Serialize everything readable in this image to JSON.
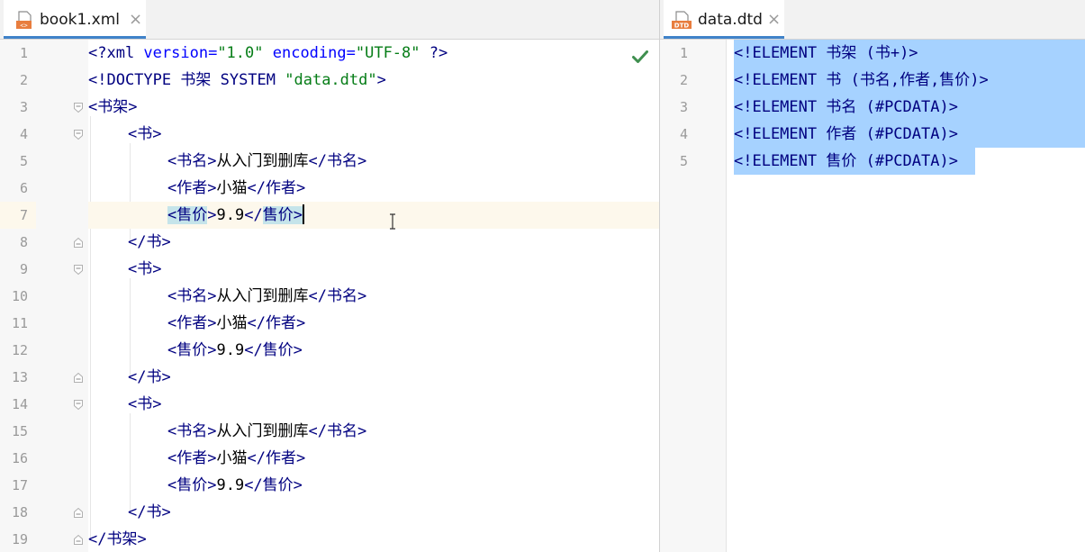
{
  "left": {
    "tab": {
      "icon": "xml-file-icon",
      "label": "book1.xml",
      "close": "×"
    },
    "status_icon": "checkmark-icon",
    "line_numbers": [
      "1",
      "2",
      "3",
      "4",
      "5",
      "6",
      "7",
      "8",
      "9",
      "10",
      "11",
      "12",
      "13",
      "14",
      "15",
      "16",
      "17",
      "18",
      "19"
    ],
    "lines": {
      "l1": {
        "pi_open": "<?xml ",
        "a1": "version=",
        "v1": "\"1.0\"",
        "a2": " encoding=",
        "v2": "\"UTF-8\"",
        "pi_close": " ?>"
      },
      "l2": {
        "kw": "<!DOCTYPE ",
        "name": "书架",
        "sys": " SYSTEM ",
        "str": "\"data.dtd\"",
        "close": ">"
      },
      "l3": {
        "tag": "<书架>"
      },
      "l4": {
        "tag": "<书>"
      },
      "l5": {
        "open": "<书名>",
        "text": "从入门到删库",
        "close": "</书名>"
      },
      "l6": {
        "open": "<作者>",
        "text": "小猫",
        "close": "</作者>"
      },
      "l7": {
        "open_lt": "<",
        "open_name": "售价",
        "open_gt": ">",
        "text": "9.9",
        "close_lt": "</",
        "close_name": "售价",
        "close_gt": ">"
      },
      "l8": {
        "tag": "</书>"
      },
      "l9": {
        "tag": "<书>"
      },
      "l10": {
        "open": "<书名>",
        "text": "从入门到删库",
        "close": "</书名>"
      },
      "l11": {
        "open": "<作者>",
        "text": "小猫",
        "close": "</作者>"
      },
      "l12": {
        "open": "<售价>",
        "text": "9.9",
        "close": "</售价>"
      },
      "l13": {
        "tag": "</书>"
      },
      "l14": {
        "tag": "<书>"
      },
      "l15": {
        "open": "<书名>",
        "text": "从入门到删库",
        "close": "</书名>"
      },
      "l16": {
        "open": "<作者>",
        "text": "小猫",
        "close": "</作者>"
      },
      "l17": {
        "open": "<售价>",
        "text": "9.9",
        "close": "</售价>"
      },
      "l18": {
        "tag": "</书>"
      },
      "l19": {
        "tag": "</书架>"
      }
    }
  },
  "right": {
    "tab": {
      "icon": "dtd-file-icon",
      "icon_text": "DTD",
      "label": "data.dtd",
      "close": "×"
    },
    "line_numbers": [
      "1",
      "2",
      "3",
      "4",
      "5"
    ],
    "lines": {
      "d1": {
        "kw": "<!ELEMENT ",
        "name": "书架",
        "rest": " (书+)>"
      },
      "d2": {
        "kw": "<!ELEMENT ",
        "name": "书",
        "rest": " (书名,作者,售价)>"
      },
      "d3": {
        "kw": "<!ELEMENT ",
        "name": "书名",
        "rest": " (#PCDATA)>"
      },
      "d4": {
        "kw": "<!ELEMENT ",
        "name": "作者",
        "rest": " (#PCDATA)>"
      },
      "d5": {
        "kw": "<!ELEMENT ",
        "name": "售价",
        "rest": " (#PCDATA)>"
      }
    }
  },
  "colors": {
    "tab_underline": "#4083c9",
    "selection": "#a6d2ff",
    "caret_line": "#fdf8ec",
    "tag_match": "#c5e4ea",
    "check": "#3f8f4f",
    "string": "#067d17",
    "keyword": "#000080"
  }
}
